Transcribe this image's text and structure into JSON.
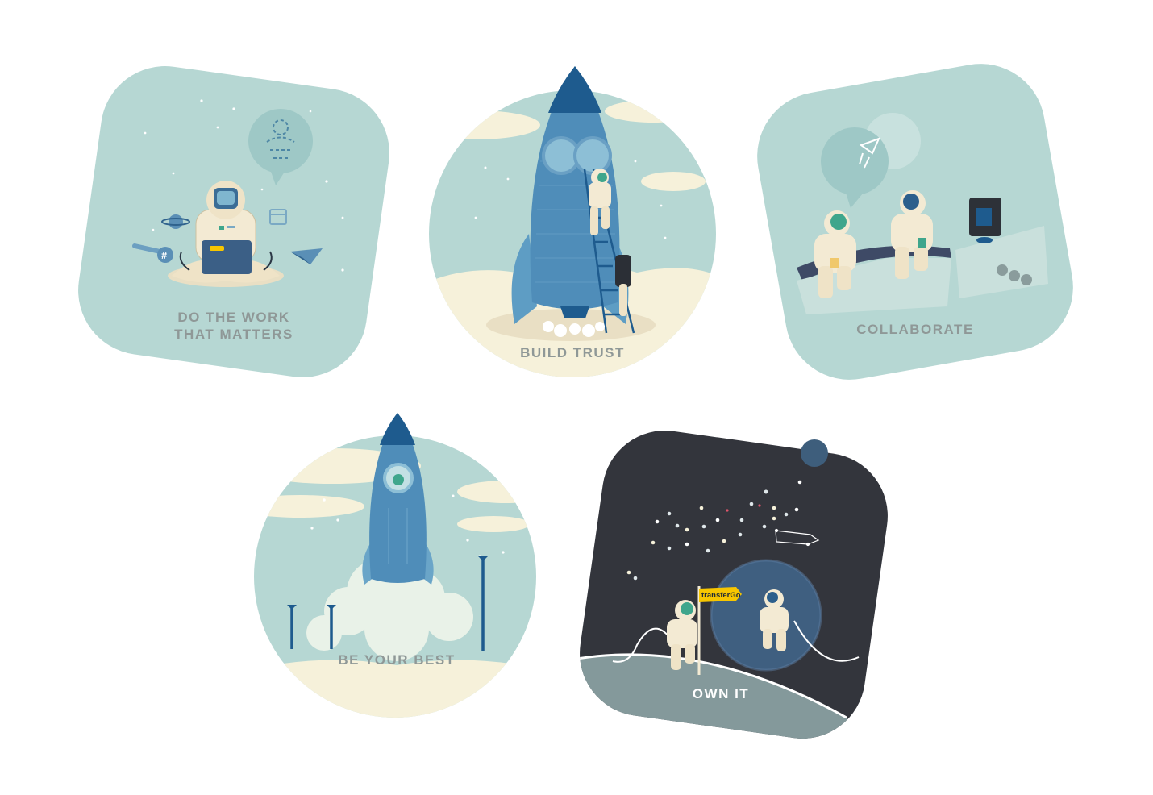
{
  "badges": {
    "do_the_work": {
      "line1": "DO THE WORK",
      "line2": "THAT MATTERS"
    },
    "build_trust": {
      "label": "BUILD TRUST"
    },
    "collaborate": {
      "label": "COLLABORATE"
    },
    "be_your_best": {
      "label": "BE YOUR BEST"
    },
    "own_it": {
      "label": "OWN IT",
      "flag_text": "transferGo"
    }
  },
  "colors": {
    "mint": "#b6d7d3",
    "cream": "#f6f1da",
    "navy": "#1e5b8e",
    "rocket": "#4f8db9",
    "dark_space": "#33353c",
    "moon_surface": "#84999b",
    "label_gray": "#8f9897",
    "flag_yellow": "#f7c600"
  },
  "icons": [
    "astronaut-icon",
    "rocket-icon",
    "laptop-icon",
    "planet-icon",
    "speech-bubble-icon",
    "flag-icon",
    "moon-icon",
    "earth-icon",
    "coffee-machine-icon",
    "ladder-icon"
  ]
}
